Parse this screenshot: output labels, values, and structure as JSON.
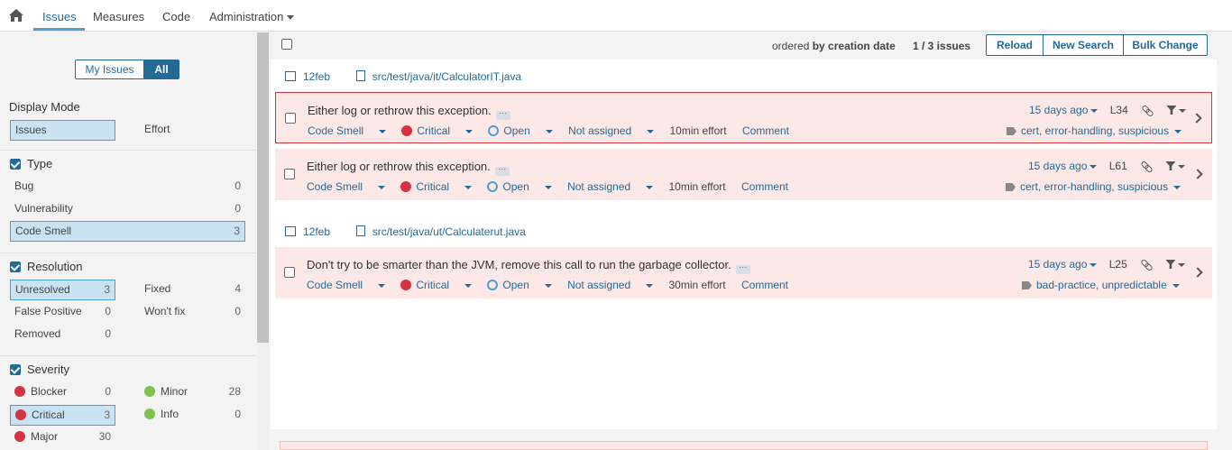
{
  "nav": {
    "tabs": [
      "Issues",
      "Measures",
      "Code",
      "Administration"
    ]
  },
  "sidebar": {
    "toggle": {
      "my_issues": "My Issues",
      "all": "All"
    },
    "display_mode": {
      "title": "Display Mode",
      "issues": "Issues",
      "effort": "Effort"
    },
    "type": {
      "title": "Type",
      "items": [
        {
          "label": "Bug",
          "count": "0"
        },
        {
          "label": "Vulnerability",
          "count": "0"
        },
        {
          "label": "Code Smell",
          "count": "3"
        }
      ]
    },
    "resolution": {
      "title": "Resolution",
      "items": [
        {
          "label": "Unresolved",
          "count": "3"
        },
        {
          "label": "Fixed",
          "count": "4"
        },
        {
          "label": "False Positive",
          "count": "0"
        },
        {
          "label": "Won't fix",
          "count": "0"
        },
        {
          "label": "Removed",
          "count": "0"
        }
      ]
    },
    "severity": {
      "title": "Severity",
      "items": [
        {
          "label": "Blocker",
          "count": "0"
        },
        {
          "label": "Minor",
          "count": "28"
        },
        {
          "label": "Critical",
          "count": "3"
        },
        {
          "label": "Info",
          "count": "0"
        },
        {
          "label": "Major",
          "count": "30"
        }
      ]
    }
  },
  "toolbar": {
    "ordered_prefix": "ordered",
    "ordered_by": "by creation date",
    "paging": "1 / 3 issues",
    "reload": "Reload",
    "new_search": "New Search",
    "bulk_change": "Bulk Change"
  },
  "groups": [
    {
      "project": "12feb",
      "file": "src/test/java/it/CalculatorIT.java"
    },
    {
      "project": "12feb",
      "file": "src/test/java/ut/Calculaterut.java"
    }
  ],
  "issues": [
    {
      "message": "Either log or rethrow this exception.",
      "dots": "...",
      "type": "Code Smell",
      "severity": "Critical",
      "status": "Open",
      "assignee": "Not assigned",
      "effort": "10min effort",
      "comment": "Comment",
      "age": "15 days ago",
      "line": "L34",
      "tags": "cert, error-handling, suspicious"
    },
    {
      "message": "Either log or rethrow this exception.",
      "dots": "...",
      "type": "Code Smell",
      "severity": "Critical",
      "status": "Open",
      "assignee": "Not assigned",
      "effort": "10min effort",
      "comment": "Comment",
      "age": "15 days ago",
      "line": "L61",
      "tags": "cert, error-handling, suspicious"
    },
    {
      "message": "Don't try to be smarter than the JVM, remove this call to run the garbage collector.",
      "dots": "...",
      "type": "Code Smell",
      "severity": "Critical",
      "status": "Open",
      "assignee": "Not assigned",
      "effort": "30min effort",
      "comment": "Comment",
      "age": "15 days ago",
      "line": "L25",
      "tags": "bad-practice, unpredictable"
    }
  ],
  "colors": {
    "accent": "#236a97",
    "issue_bg": "#fde8e8",
    "critical": "#d4333f",
    "minor": "#7ec34d"
  }
}
